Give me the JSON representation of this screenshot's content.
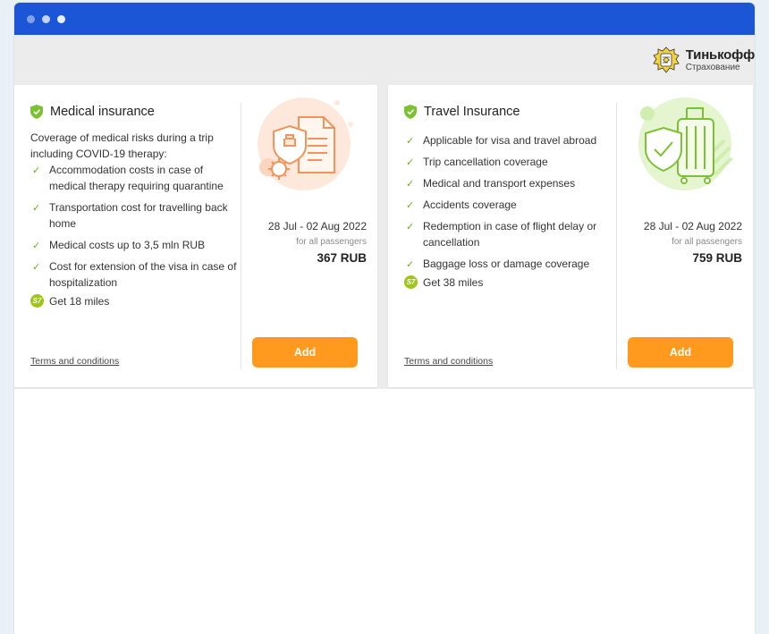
{
  "window": {
    "controls": [
      "close",
      "minimize",
      "maximize"
    ]
  },
  "brand": {
    "name": "Тинькофф",
    "subtitle": "Страхование",
    "emblem_icon": "lion-crest-icon"
  },
  "accent": {
    "button_color": "#ff9a1f",
    "check_color": "#6aac1c",
    "shield_color": "#7cc034",
    "titlebar_color": "#1a56d6"
  },
  "cards": [
    {
      "title": "Medical insurance",
      "description": "Coverage of medical risks during a trip including COVID-19 therapy:",
      "items": [
        "Accommodation costs in case of medical therapy requiring quarantine",
        "Transportation cost for travelling back home",
        "Medical costs up to 3,5 mln RUB",
        "Cost for extension of the visa in case of hospitalization"
      ],
      "miles_badge": "S7",
      "miles": "Get 18 miles",
      "terms": "Terms and conditions",
      "dates": "28 Jul - 02 Aug 2022",
      "passengers": "for all passengers",
      "price": "367 RUB",
      "add_label": "Add",
      "illustration": "medical-document-shield-icon"
    },
    {
      "title": "Travel Insurance",
      "items": [
        "Applicable for visa and travel abroad",
        "Trip cancellation coverage",
        "Medical and transport expenses",
        "Accidents coverage",
        "Redemption in case of flight delay or cancellation",
        "Baggage loss or damage coverage"
      ],
      "miles_badge": "S7",
      "miles": "Get 38 miles",
      "terms": "Terms and conditions",
      "dates": "28 Jul - 02 Aug 2022",
      "passengers": "for all passengers",
      "price": "759 RUB",
      "add_label": "Add",
      "illustration": "luggage-shield-icon"
    }
  ]
}
